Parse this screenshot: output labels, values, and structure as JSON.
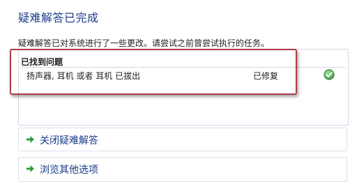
{
  "page": {
    "title": "疑难解答已完成",
    "description": "疑难解答已对系统进行了一些更改。请尝试之前曾尝试执行的任务。"
  },
  "results": {
    "header": "已找到问题",
    "items": [
      {
        "problem": "扬声器, 耳机 或者 耳机 已拔出",
        "status": "已修复",
        "icon": "check-icon",
        "icon_color": "#4caf50"
      }
    ],
    "highlight_color": "#b03a45"
  },
  "options": [
    {
      "label": "关闭疑难解答",
      "icon": "green-arrow-icon"
    },
    {
      "label": "浏览其他选项",
      "icon": "green-arrow-icon"
    }
  ],
  "colors": {
    "title": "#1b3d8a",
    "link": "#1b3d8a",
    "arrow": "#2e9e3a"
  }
}
